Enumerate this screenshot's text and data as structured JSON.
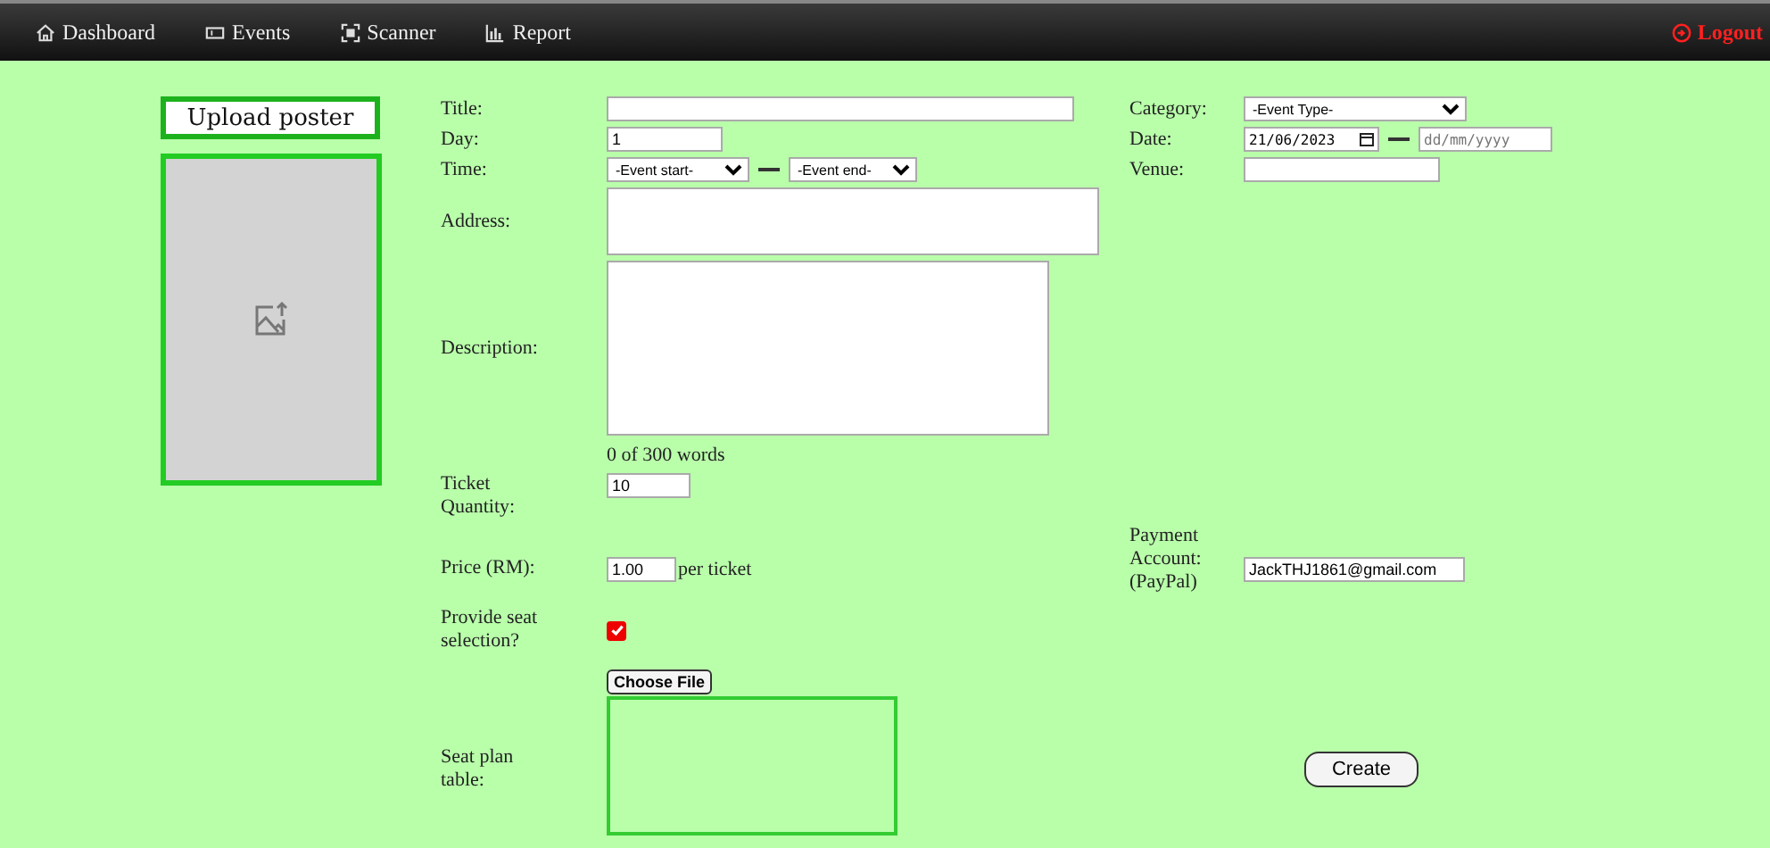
{
  "nav": {
    "items": [
      {
        "label": "Dashboard",
        "kind": "home"
      },
      {
        "label": "Events",
        "kind": "ticket"
      },
      {
        "label": "Scanner",
        "kind": "scanner"
      },
      {
        "label": "Report",
        "kind": "chart"
      }
    ],
    "logout": "Logout"
  },
  "poster": {
    "button": "Upload poster"
  },
  "form": {
    "title": {
      "label": "Title:"
    },
    "day": {
      "label": "Day:",
      "value": "1"
    },
    "time": {
      "label": "Time:",
      "start": "-Event start-",
      "end": "-Event end-"
    },
    "address": {
      "label": "Address:"
    },
    "description": {
      "label": "Description:",
      "counter": "0 of 300 words"
    },
    "ticket_quantity": {
      "label": "Ticket Quantity:",
      "value": "10"
    },
    "price": {
      "label": "Price (RM):",
      "value": "1.00",
      "suffix": "per ticket"
    },
    "seat_selection": {
      "label": "Provide seat selection?",
      "checked": true
    },
    "seat_plan": {
      "label": "Seat plan table:",
      "button": "Choose File"
    },
    "category": {
      "label": "Category:",
      "value": "-Event Type-"
    },
    "date": {
      "label": "Date:",
      "start": "21/06/2023",
      "end_placeholder": "dd/mm/yyyy"
    },
    "venue": {
      "label": "Venue:"
    },
    "payment": {
      "label": "Payment Account: (PayPal)",
      "value": "JackTHJ1861@gmail.com"
    },
    "create": "Create"
  }
}
